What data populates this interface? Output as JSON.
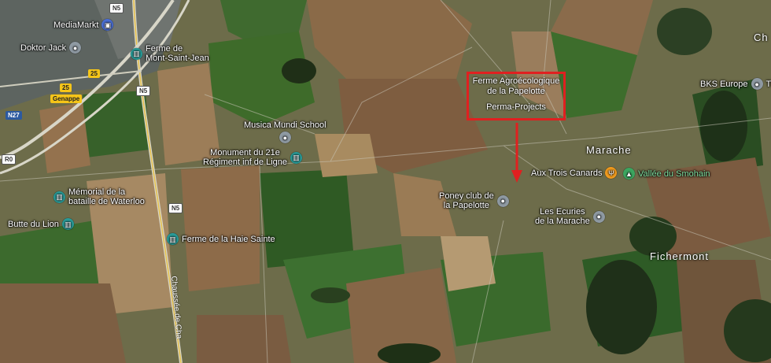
{
  "callout": {
    "title_line1": "Ferme Agroécologique",
    "title_line2": "de la Papelotte",
    "subtitle": "Perma-Projects",
    "color": "#e02020"
  },
  "pois": {
    "mediamarkt": "MediaMarkt",
    "doktor_jack": "Doktor Jack",
    "ferme_mont_saint_jean_1": "Ferme de",
    "ferme_mont_saint_jean_2": "Mont-Saint-Jean",
    "musica_mundi": "Musica Mundi School",
    "monument_1": "Monument du 21e",
    "monument_2": "Régiment inf de Ligne",
    "memorial_1": "Mémorial de la",
    "memorial_2": "bataille de Waterloo",
    "butte": "Butte du Lion",
    "haie_sainte": "Ferme de la Haie Sainte",
    "poney_1": "Poney club de",
    "poney_2": "la Papelotte",
    "trois_canards": "Aux Trois Canards",
    "vallee": "Vallée du Smohain",
    "ecuries_1": "Les Ecuries",
    "ecuries_2": "de la Marache",
    "bks": "BKS Europe",
    "th": "TI"
  },
  "towns": {
    "marache": "Marache",
    "fichermont": "Fichermont",
    "edge": "Ch"
  },
  "shields": {
    "n5_top": "N5",
    "n5_mid": "N5",
    "n5_low": "N5",
    "r25a": "25",
    "r25b": "25",
    "n27": "N27",
    "r0": "R0",
    "genappe": "Genappe"
  },
  "roads": {
    "chaussee": "Chaussée de Cha"
  },
  "icons": {
    "poi_generic": "map-pin-icon",
    "poi_landmark": "landmark-icon",
    "restaurant": "fork-knife-icon",
    "park": "tree-icon",
    "shopping": "shopping-bag-icon"
  }
}
